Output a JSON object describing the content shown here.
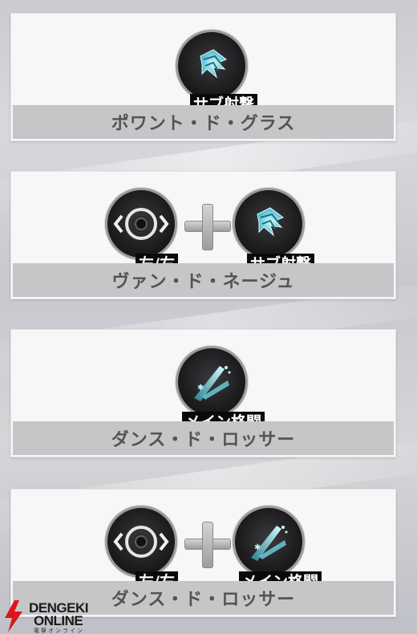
{
  "combos": [
    {
      "name": "ポワント・ド・グラス",
      "inputs": [
        {
          "icon": "sub-shot-ice-icon",
          "label": "サブ射撃"
        }
      ]
    },
    {
      "name": "ヴァン・ド・ネージュ",
      "inputs": [
        {
          "icon": "direction-left-right-icon",
          "label": "左/右"
        },
        {
          "icon": "sub-shot-ice-icon",
          "label": "サブ射撃"
        }
      ]
    },
    {
      "name": "ダンス・ド・ロッサー",
      "inputs": [
        {
          "icon": "main-melee-ice-blade-icon",
          "label": "メイン格闘"
        }
      ]
    },
    {
      "name": "ダンス・ド・ロッサー",
      "inputs": [
        {
          "icon": "direction-left-right-icon",
          "label": "左/右"
        },
        {
          "icon": "main-melee-ice-blade-icon",
          "label": "メイン格闘"
        }
      ]
    }
  ],
  "watermark": {
    "line1": "DENGEKI",
    "line2": "ONLINE",
    "line3": "電撃オンライン"
  },
  "colors": {
    "ice_accent": "#8fe3f0",
    "band": "#c6c6c8",
    "label_bg": "#0a0a0a"
  }
}
